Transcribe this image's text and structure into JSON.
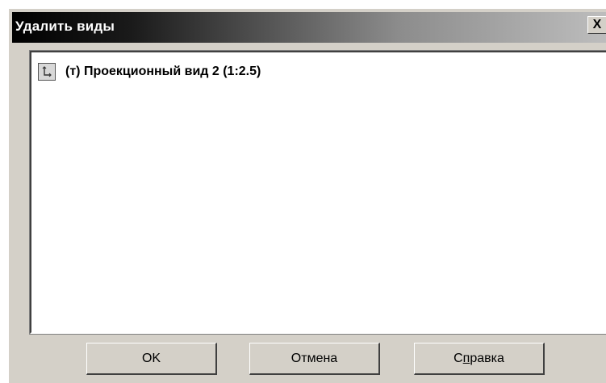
{
  "window": {
    "title": "Удалить виды",
    "close_glyph": "X"
  },
  "list": {
    "items": [
      {
        "icon": "projection-view-icon",
        "label": "(т) Проекционный вид 2 (1:2.5)"
      }
    ]
  },
  "buttons": {
    "ok": "OK",
    "cancel": "Отмена",
    "help_prefix": "С",
    "help_mnemonic": "п",
    "help_suffix": "равка"
  }
}
